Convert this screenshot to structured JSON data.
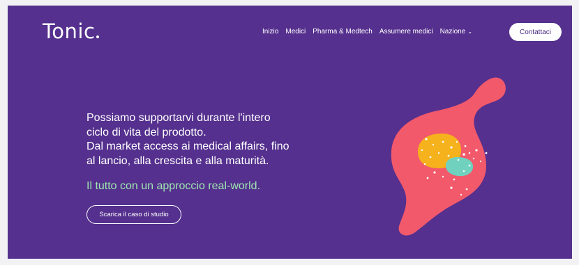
{
  "header": {
    "logo": "Tonic",
    "nav": [
      {
        "label": "Inizio"
      },
      {
        "label": "Medici"
      },
      {
        "label": "Pharma & Medtech"
      },
      {
        "label": "Assumere medici"
      },
      {
        "label": "Nazione",
        "chevron": "⌄"
      }
    ],
    "cta_label": "Contattaci"
  },
  "hero": {
    "lines": [
      "Possiamo supportarvi durante l'intero",
      "ciclo di vita del prodotto.",
      "Dal market access ai medical affairs, fino",
      "al lancio, alla crescita e alla maturità."
    ],
    "tagline": "Il tutto con un approccio real-world.",
    "button_label": "Scarica il caso di studio"
  },
  "illustration": {
    "icon": "stomach-illustration",
    "colors": {
      "body": "#f2596b",
      "yellow": "#f5b21c",
      "teal": "#6fd1be",
      "background": "#55308e"
    }
  }
}
